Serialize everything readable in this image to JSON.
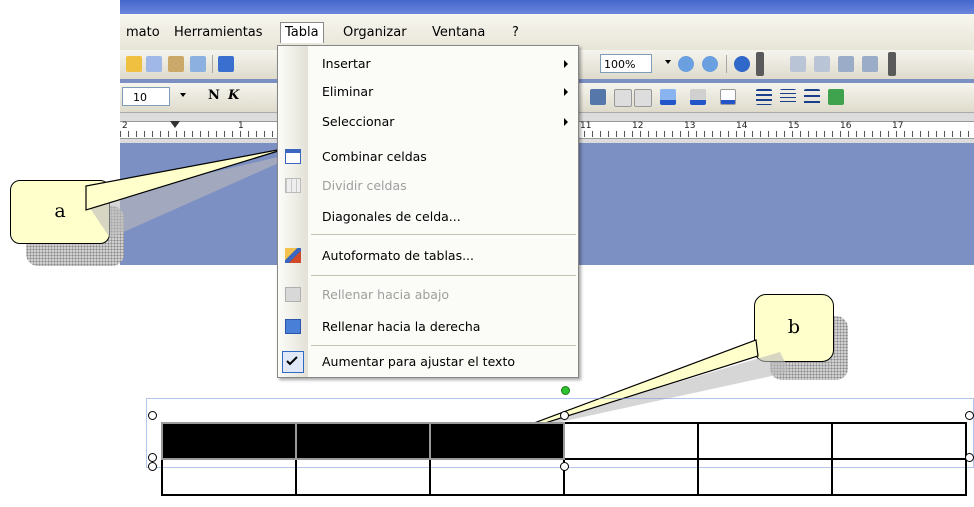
{
  "menubar": {
    "items": [
      "mato",
      "Herramientas",
      "Tabla",
      "Organizar",
      "Ventana",
      "?"
    ]
  },
  "toolbar": {
    "zoom": "100%",
    "font_size": "10",
    "bold": "N",
    "italic": "K"
  },
  "ruler": {
    "ticks": [
      "2",
      "1",
      "11",
      "12",
      "13",
      "14",
      "15",
      "16",
      "17"
    ]
  },
  "dropdown": {
    "items": [
      {
        "label": "Insertar",
        "submenu": true,
        "disabled": false,
        "icon": "none"
      },
      {
        "label": "Eliminar",
        "submenu": true,
        "disabled": false,
        "icon": "none"
      },
      {
        "label": "Seleccionar",
        "submenu": true,
        "disabled": false,
        "icon": "none"
      },
      {
        "label": "Combinar celdas",
        "submenu": false,
        "disabled": false,
        "icon": "merge-cells-icon"
      },
      {
        "label": "Dividir celdas",
        "submenu": false,
        "disabled": true,
        "icon": "split-cells-icon"
      },
      {
        "label": "Diagonales de celda...",
        "submenu": false,
        "disabled": false,
        "icon": "none"
      },
      {
        "label": "Autoformato de tablas...",
        "submenu": false,
        "disabled": false,
        "icon": "autoformat-icon"
      },
      {
        "label": "Rellenar hacia abajo",
        "submenu": false,
        "disabled": true,
        "icon": "fill-down-icon"
      },
      {
        "label": "Rellenar hacia la derecha",
        "submenu": false,
        "disabled": false,
        "icon": "fill-right-icon"
      },
      {
        "label": "Aumentar para ajustar el texto",
        "submenu": false,
        "disabled": false,
        "icon": "checkmark-icon"
      }
    ]
  },
  "callouts": {
    "a": "a",
    "b": "b"
  },
  "colors": {
    "window_bg": "#7d90c4",
    "selected_cell": "#000000",
    "callout_fill": "#ffffcc"
  }
}
